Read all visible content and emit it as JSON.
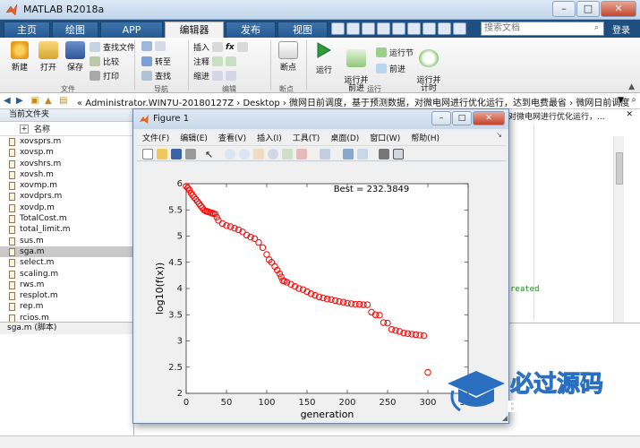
{
  "window": {
    "title": "MATLAB R2018a",
    "minimize": "–",
    "maximize": "□",
    "close": "✕"
  },
  "tabs": [
    "主页",
    "绘图",
    "APP",
    "编辑器",
    "发布",
    "视图"
  ],
  "search": {
    "placeholder": "搜索文档"
  },
  "login_label": "登录",
  "ribbon": {
    "new": "新建",
    "open": "打开",
    "save": "保存",
    "find_files": "查找文件",
    "compare": "比较",
    "print": "打印",
    "goto": "转至",
    "find": "查找",
    "insert": "插入",
    "fx": "fx",
    "comment": "注释",
    "indent": "缩进",
    "breakpoint": "断点",
    "run": "运行",
    "run_advance": "运行并\n前进",
    "run_section": "运行节",
    "advance": "前进",
    "run_time": "运行并\n计时",
    "sections": [
      "文件",
      "导航",
      "编辑",
      "断点",
      "运行"
    ]
  },
  "address": {
    "path": "« Administrator.WIN7U-20180127Z › Desktop › 微网日前调度，基于预测数据，对微电网进行优化运行，达到电费最省 › 微网日前调度"
  },
  "left_panel": {
    "title": "当前文件夹",
    "column": "名称",
    "files": [
      "xovsprs.m",
      "xovsp.m",
      "xovshrs.m",
      "xovsh.m",
      "xovmp.m",
      "xovdprs.m",
      "xovdp.m",
      "TotalCost.m",
      "total_limit.m",
      "sus.m",
      "sga.m",
      "select.m",
      "scaling.m",
      "rws.m",
      "resplot.m",
      "rep.m",
      "rcios.m"
    ],
    "selected": "sga.m",
    "file_info": "sga.m  (脚本)"
  },
  "editor": {
    "tab_text": "对微电网进行优化运行，...",
    "code_fragment": "reated"
  },
  "figure": {
    "title": "Figure 1",
    "menu": [
      "文件(F)",
      "编辑(E)",
      "查看(V)",
      "插入(I)",
      "工具(T)",
      "桌面(D)",
      "窗口(W)",
      "帮助(H)"
    ]
  },
  "chart_data": {
    "type": "scatter",
    "annotation": "Best = 232.3849",
    "xlabel": "generation",
    "ylabel": "log10(f(x))",
    "xlim": [
      0,
      350
    ],
    "ylim": [
      2,
      6
    ],
    "xticks": [
      0,
      50,
      100,
      150,
      200,
      250,
      300,
      350
    ],
    "yticks": [
      2,
      2.5,
      3,
      3.5,
      4,
      4.5,
      5,
      5.5,
      6
    ],
    "marker": "o",
    "color": "#ff0000",
    "x": [
      0,
      2,
      4,
      6,
      8,
      10,
      12,
      14,
      16,
      18,
      20,
      22,
      24,
      26,
      28,
      30,
      32,
      34,
      36,
      38,
      40,
      45,
      50,
      55,
      60,
      65,
      70,
      75,
      80,
      85,
      90,
      95,
      100,
      103,
      106,
      110,
      113,
      116,
      118,
      120,
      122,
      125,
      130,
      135,
      140,
      145,
      150,
      155,
      160,
      165,
      170,
      175,
      180,
      185,
      190,
      195,
      200,
      205,
      210,
      215,
      220,
      225,
      230,
      235,
      240,
      245,
      250,
      255,
      260,
      265,
      270,
      275,
      280,
      285,
      290,
      295,
      300
    ],
    "y": [
      5.95,
      5.92,
      5.88,
      5.82,
      5.78,
      5.74,
      5.7,
      5.66,
      5.62,
      5.58,
      5.54,
      5.5,
      5.48,
      5.47,
      5.46,
      5.45,
      5.44,
      5.43,
      5.42,
      5.36,
      5.3,
      5.24,
      5.2,
      5.18,
      5.15,
      5.12,
      5.08,
      5.02,
      4.98,
      4.95,
      4.88,
      4.78,
      4.65,
      4.55,
      4.5,
      4.42,
      4.35,
      4.28,
      4.22,
      4.15,
      4.14,
      4.12,
      4.08,
      4.04,
      4.0,
      3.98,
      3.94,
      3.9,
      3.87,
      3.84,
      3.82,
      3.8,
      3.79,
      3.77,
      3.75,
      3.74,
      3.72,
      3.71,
      3.7,
      3.7,
      3.69,
      3.69,
      3.55,
      3.5,
      3.49,
      3.35,
      3.34,
      3.22,
      3.2,
      3.18,
      3.15,
      3.14,
      3.13,
      3.12,
      3.11,
      3.1,
      2.4
    ]
  },
  "watermark": {
    "main": "必过源码",
    "sub": "Biguo100.CN"
  },
  "colors": {
    "marker": "#ff0000",
    "ribbon_blue": "#1f4e80",
    "accent": "#2a6fbf"
  }
}
